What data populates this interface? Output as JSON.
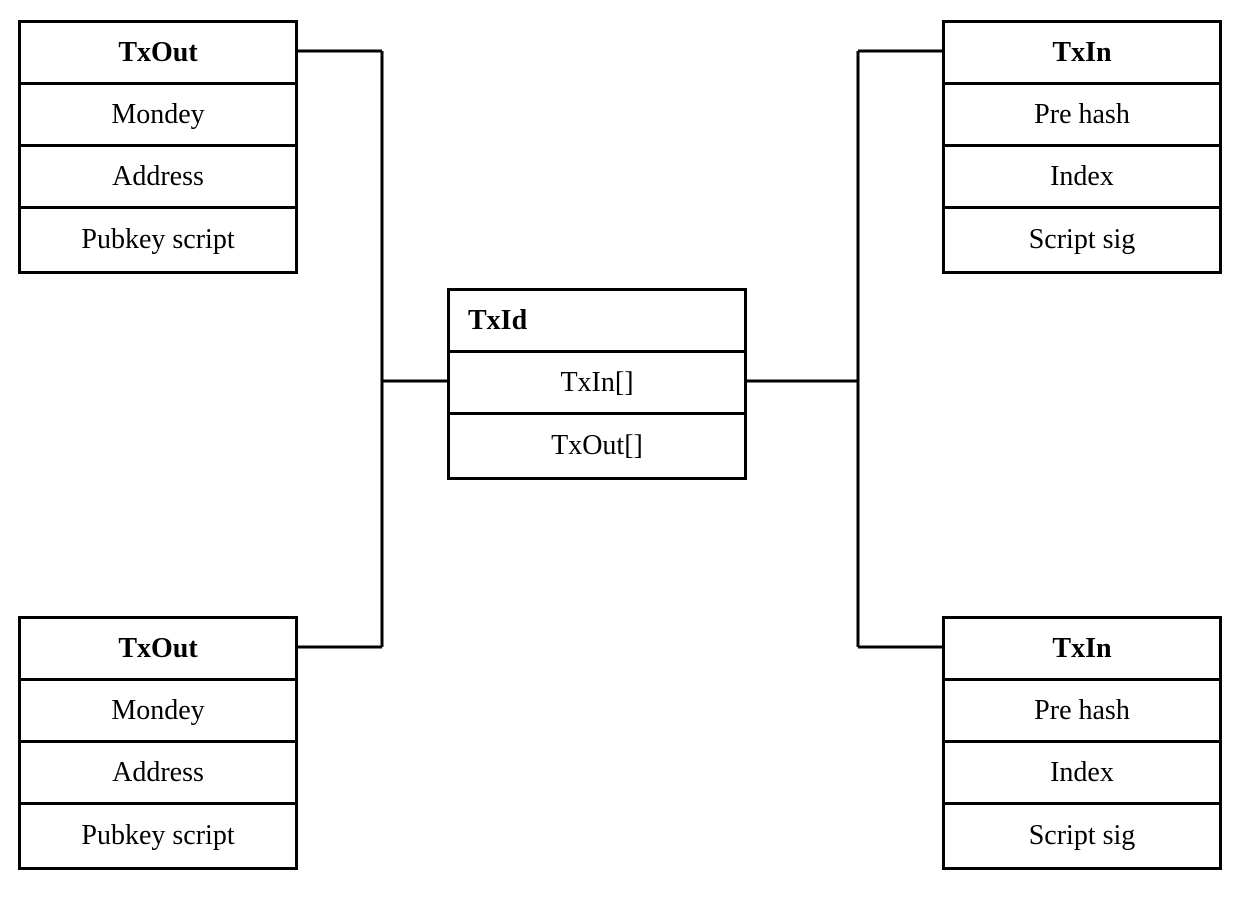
{
  "txout_top": {
    "title": "TxOut",
    "fields": [
      "Mondey",
      "Address",
      "Pubkey script"
    ]
  },
  "txout_bottom": {
    "title": "TxOut",
    "fields": [
      "Mondey",
      "Address",
      "Pubkey script"
    ]
  },
  "txin_top": {
    "title": "TxIn",
    "fields": [
      "Pre hash",
      "Index",
      "Script sig"
    ]
  },
  "txin_bottom": {
    "title": "TxIn",
    "fields": [
      "Pre hash",
      "Index",
      "Script sig"
    ]
  },
  "txid": {
    "title": "TxId",
    "fields": [
      "TxIn[]",
      "TxOut[]"
    ]
  }
}
